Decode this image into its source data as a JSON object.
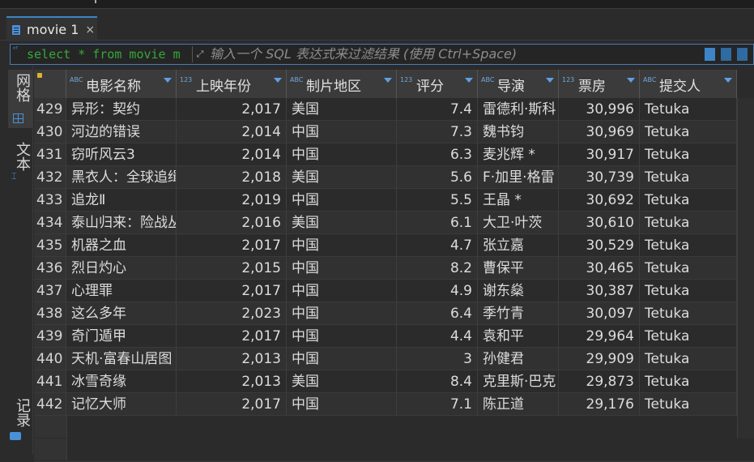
{
  "tab": {
    "label": "movie 1",
    "close": "×"
  },
  "filter": {
    "sql_icon": "ᵒᵀ",
    "sql_text": "select * from movie m",
    "expand_icon": "⤢",
    "placeholder": "输入一个 SQL 表达式来过滤结果 (使用 Ctrl+Space)"
  },
  "sidebar": {
    "grid_label": "网格",
    "text_label": "文本",
    "record_label": "记录"
  },
  "columns": [
    {
      "type": "ABC",
      "label": "电影名称"
    },
    {
      "type": "123",
      "label": "上映年份"
    },
    {
      "type": "ABC",
      "label": "制片地区"
    },
    {
      "type": "123",
      "label": "评分"
    },
    {
      "type": "ABC",
      "label": "导演"
    },
    {
      "type": "123",
      "label": "票房"
    },
    {
      "type": "ABC",
      "label": "提交人"
    }
  ],
  "rows": [
    {
      "n": "429",
      "name": "异形：契约",
      "year": "2,017",
      "region": "美国",
      "score": "7.4",
      "director": "雷德利·斯科",
      "box": "30,996",
      "user": "Tetuka"
    },
    {
      "n": "430",
      "name": "河边的错误",
      "year": "2,014",
      "region": "中国",
      "score": "7.3",
      "director": "魏书钧",
      "box": "30,969",
      "user": "Tetuka"
    },
    {
      "n": "431",
      "name": "窃听风云3",
      "year": "2,014",
      "region": "中国",
      "score": "6.3",
      "director": "麦兆辉 *",
      "box": "30,917",
      "user": "Tetuka"
    },
    {
      "n": "432",
      "name": "黑衣人：全球追缉",
      "year": "2,018",
      "region": "美国",
      "score": "5.6",
      "director": "F·加里·格雷",
      "box": "30,739",
      "user": "Tetuka"
    },
    {
      "n": "433",
      "name": "追龙Ⅱ",
      "year": "2,019",
      "region": "中国",
      "score": "5.5",
      "director": "王晶 *",
      "box": "30,692",
      "user": "Tetuka"
    },
    {
      "n": "434",
      "name": "泰山归来：险战丛林",
      "year": "2,016",
      "region": "美国",
      "score": "6.1",
      "director": "大卫·叶茨",
      "box": "30,610",
      "user": "Tetuka"
    },
    {
      "n": "435",
      "name": "机器之血",
      "year": "2,017",
      "region": "中国",
      "score": "4.7",
      "director": "张立嘉",
      "box": "30,529",
      "user": "Tetuka"
    },
    {
      "n": "436",
      "name": "烈日灼心",
      "year": "2,015",
      "region": "中国",
      "score": "8.2",
      "director": "曹保平",
      "box": "30,465",
      "user": "Tetuka"
    },
    {
      "n": "437",
      "name": "心理罪",
      "year": "2,017",
      "region": "中国",
      "score": "4.9",
      "director": "谢东燊",
      "box": "30,387",
      "user": "Tetuka"
    },
    {
      "n": "438",
      "name": "这么多年",
      "year": "2,023",
      "region": "中国",
      "score": "6.4",
      "director": "季竹青",
      "box": "30,097",
      "user": "Tetuka"
    },
    {
      "n": "439",
      "name": "奇门遁甲",
      "year": "2,017",
      "region": "中国",
      "score": "4.4",
      "director": "袁和平",
      "box": "29,964",
      "user": "Tetuka"
    },
    {
      "n": "440",
      "name": "天机·富春山居图",
      "year": "2,013",
      "region": "中国",
      "score": "3",
      "director": "孙健君",
      "box": "29,909",
      "user": "Tetuka"
    },
    {
      "n": "441",
      "name": "冰雪奇缘",
      "year": "2,013",
      "region": "美国",
      "score": "8.4",
      "director": "克里斯·巴克",
      "box": "29,873",
      "user": "Tetuka"
    },
    {
      "n": "442",
      "name": "记忆大师",
      "year": "2,017",
      "region": "中国",
      "score": "7.1",
      "director": "陈正道",
      "box": "29,176",
      "user": "Tetuka"
    }
  ]
}
